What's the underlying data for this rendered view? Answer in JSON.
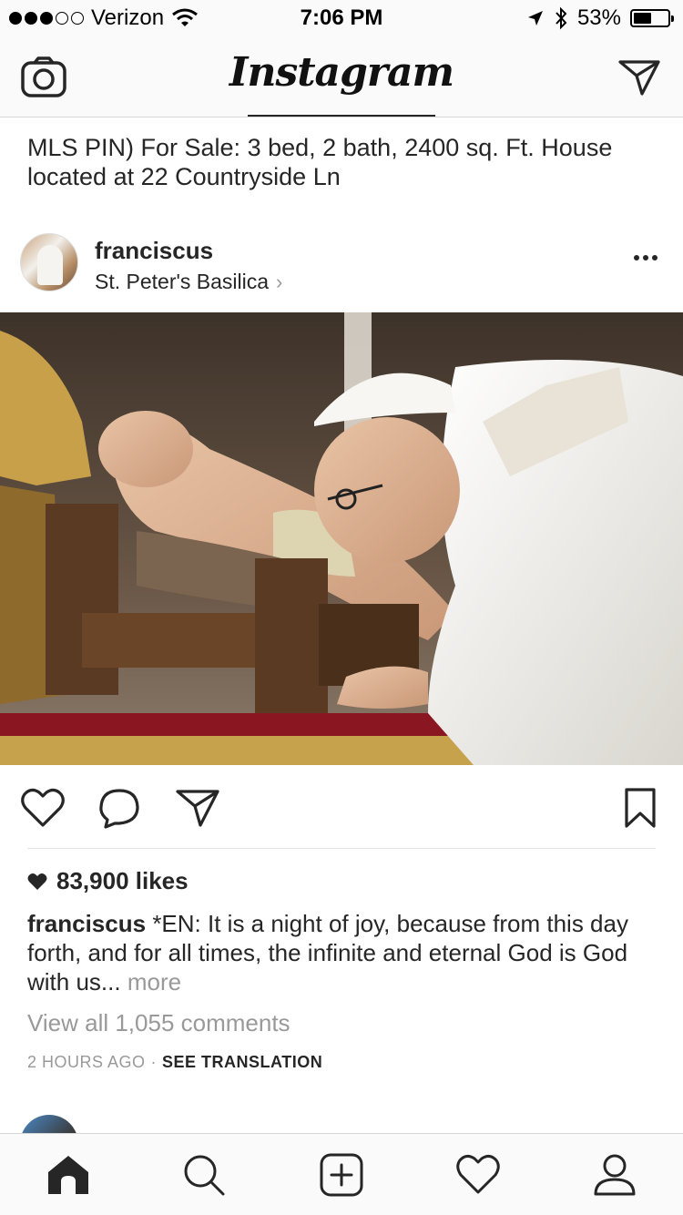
{
  "status_bar": {
    "carrier": "Verizon",
    "time": "7:06 PM",
    "battery": "53%",
    "battery_level": 0.53
  },
  "nav": {
    "logo": "Instagram",
    "left_icon": "camera-icon",
    "right_icon": "direct-message-icon"
  },
  "promo": {
    "text": "MLS PIN) For Sale: 3 bed, 2 bath, 2400 sq. Ft. House located at 22 Countryside Ln"
  },
  "post": {
    "username": "franciscus",
    "location": "St. Peter's Basilica",
    "likes": "83,900 likes",
    "caption_user": "franciscus",
    "caption_text": "*EN: It is a night of joy, because from this day forth, and for all times, the infinite and eternal God is God with us...",
    "caption_more": "more",
    "view_comments": "View all 1,055 comments",
    "time_ago": "2 HOURS AGO",
    "separator": "·",
    "see_translation": "SEE TRANSLATION"
  },
  "actions": [
    "heart-icon",
    "comment-icon",
    "share-icon",
    "bookmark-icon"
  ],
  "tab_bar": [
    "home-icon",
    "search-icon",
    "add-post-icon",
    "activity-heart-icon",
    "profile-icon"
  ]
}
